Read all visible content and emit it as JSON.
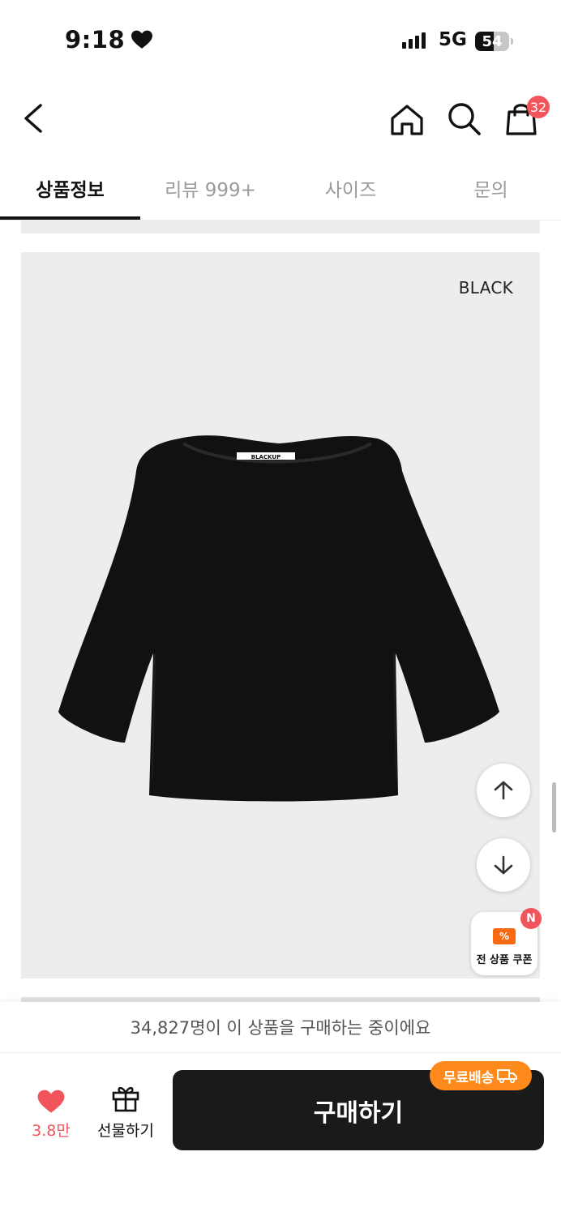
{
  "status_bar": {
    "time": "9:18",
    "network": "5G",
    "battery": "54",
    "battery_level_percent": 54
  },
  "header": {
    "cart_count": "32",
    "icons": [
      "back-icon",
      "home-icon",
      "search-icon",
      "shopping-bag-icon"
    ]
  },
  "tabs": [
    {
      "label": "상품정보",
      "active": true
    },
    {
      "label": "리뷰 999+",
      "active": false
    },
    {
      "label": "사이즈",
      "active": false
    },
    {
      "label": "문의",
      "active": false
    }
  ],
  "product_image": {
    "color_label": "BLACK",
    "garment_tag": "BLACKUP",
    "garment_color": "#111111"
  },
  "floating": {
    "scroll_up_icon": "arrow-up-icon",
    "scroll_down_icon": "arrow-down-icon",
    "coupon_icon_text": "%",
    "coupon_label": "전 상품 쿠폰",
    "coupon_badge": "N"
  },
  "bottom_bar": {
    "purchase_notice": "34,827명이 이 상품을 구매하는 중이에요",
    "like_count": "3.8만",
    "gift_label": "선물하기",
    "buy_label": "구매하기",
    "free_shipping_label": "무료배송"
  },
  "colors": {
    "accent_red": "#f2545b",
    "accent_orange": "#ff8a1c",
    "buy_button": "#1a1a1a",
    "image_background": "#ededed"
  }
}
